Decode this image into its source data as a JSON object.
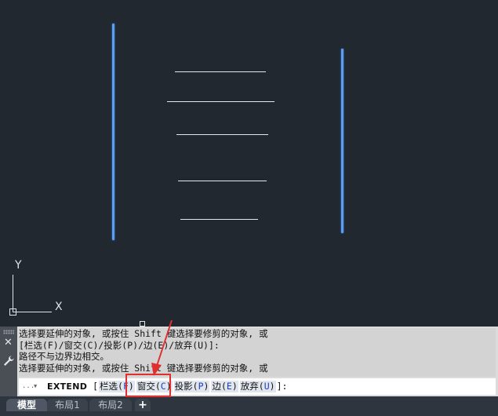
{
  "ucs": {
    "y_label": "Y",
    "x_label": "X"
  },
  "command": {
    "history": [
      "选择要延伸的对象, 或按住 Shift 键选择要修剪的对象, 或",
      "[栏选(F)/窗交(C)/投影(P)/边(E)/放弃(U)]:",
      "路径不与边界边相交。",
      "选择要延伸的对象, 或按住 Shift 键选择要修剪的对象, 或"
    ],
    "prompt_icon": "...",
    "prompt_name": "EXTEND",
    "open_bracket": " [",
    "options": [
      {
        "label": "栏选",
        "key": "F"
      },
      {
        "label": "窗交",
        "key": "C"
      },
      {
        "label": "投影",
        "key": "P"
      },
      {
        "label": "边",
        "key": "E"
      },
      {
        "label": "放弃",
        "key": "U"
      }
    ],
    "close_bracket": "]:"
  },
  "side": {
    "close_glyph": "✕"
  },
  "tabs": {
    "model": "模型",
    "layout1": "布局1",
    "layout2": "布局2",
    "add": "+"
  },
  "colors": {
    "canvas": "#212830",
    "boundary": "#5d9ef0",
    "highlight": "#e12f2f"
  }
}
